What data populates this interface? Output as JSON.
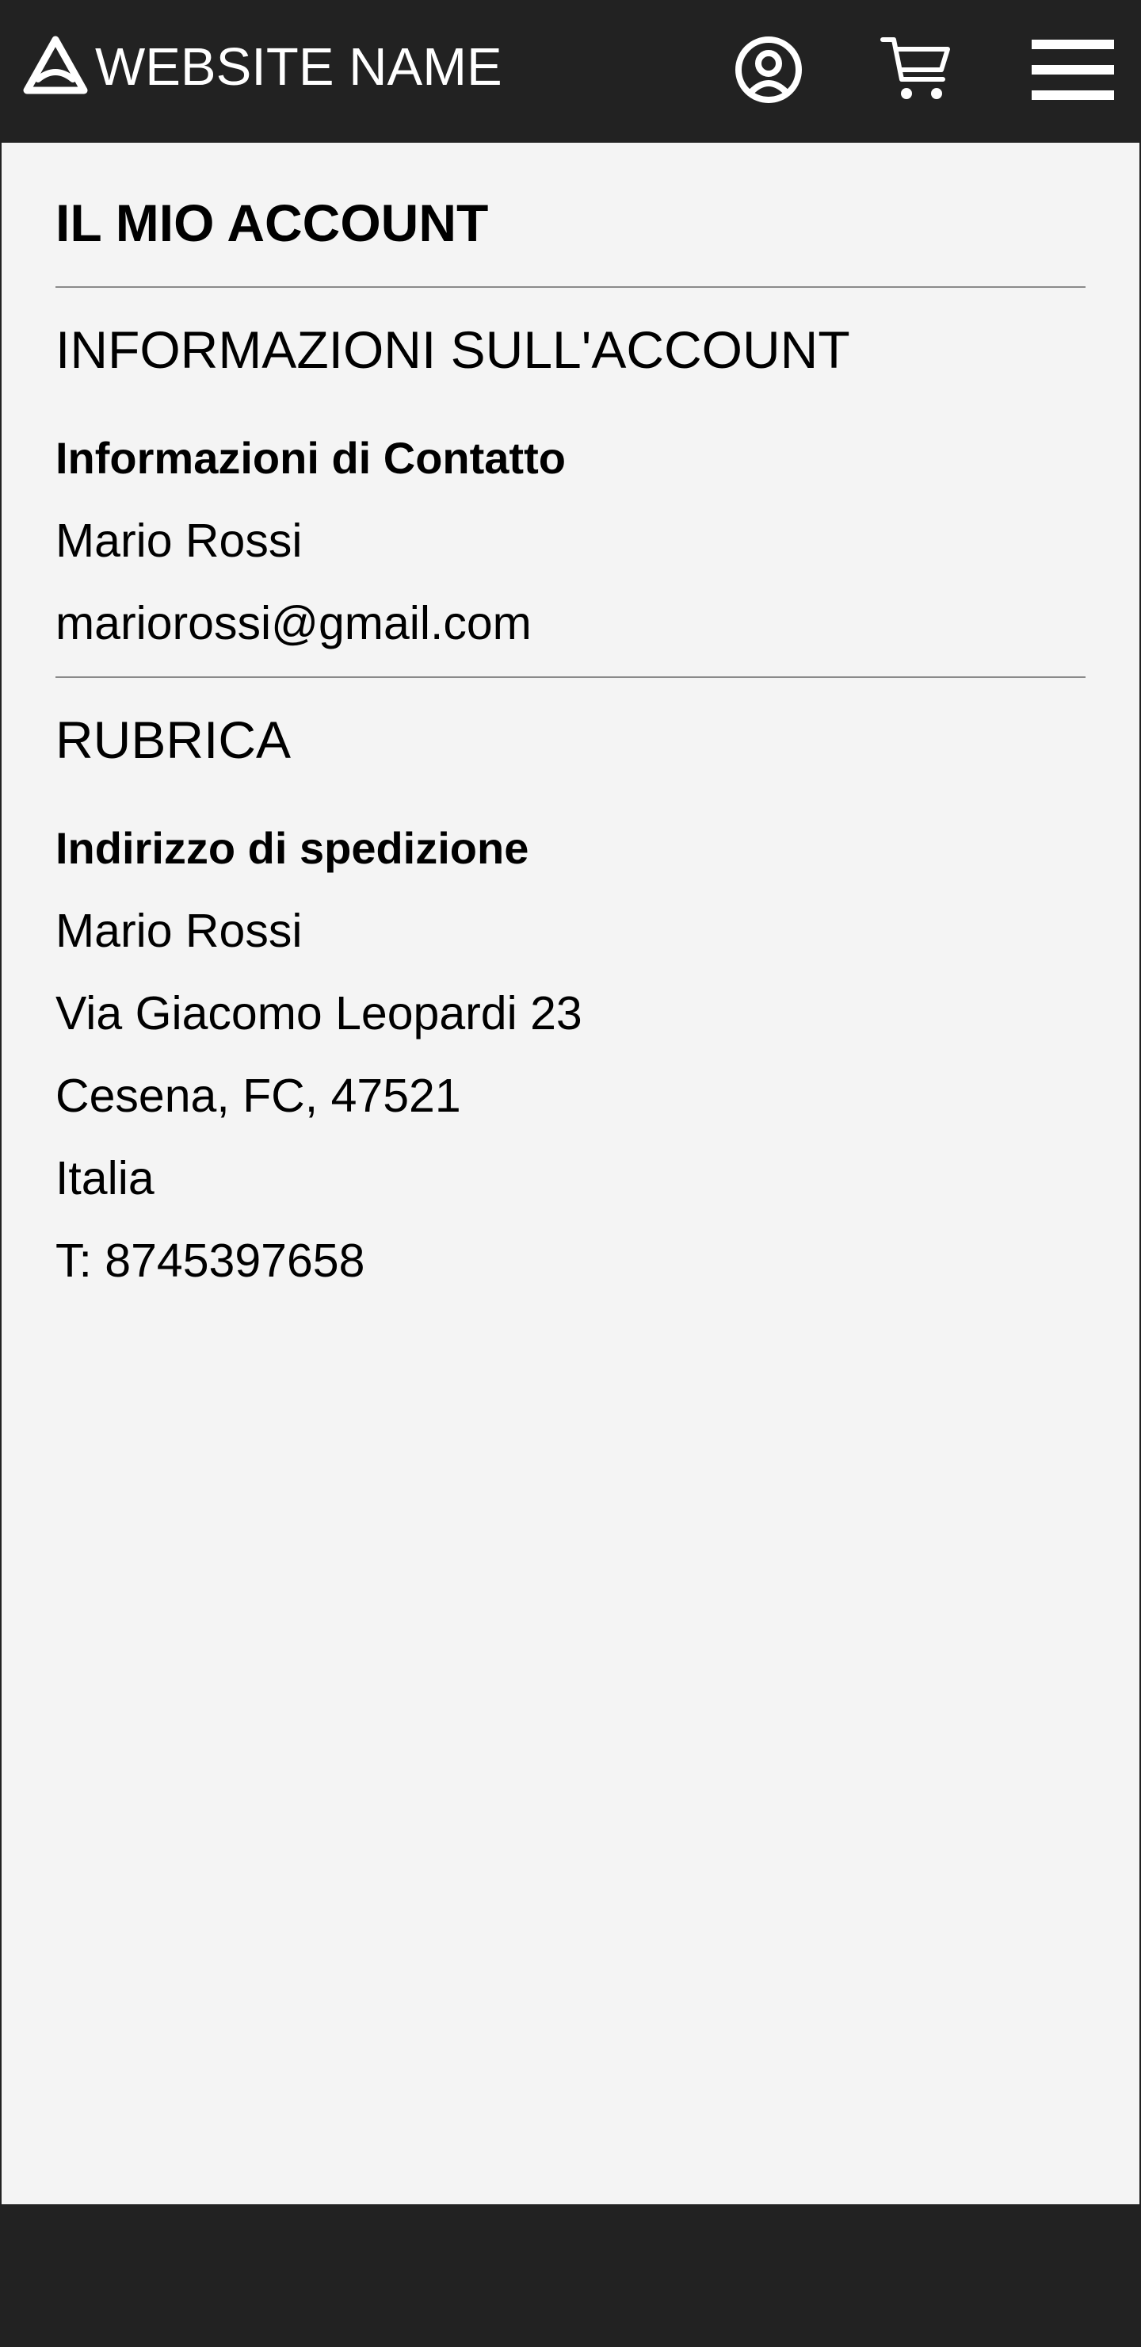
{
  "header": {
    "site_name": "WEBSITE NAME",
    "icons": {
      "logo": "triangle-logo-icon",
      "account": "user-circle-icon",
      "cart": "cart-icon",
      "menu": "hamburger-menu-icon"
    },
    "colors": {
      "background": "#222222",
      "foreground": "#ffffff"
    }
  },
  "main": {
    "page_title": "IL MIO ACCOUNT",
    "account_info": {
      "section_title": "INFORMAZIONI SULL'ACCOUNT",
      "contact_title": "Informazioni di Contatto",
      "name": "Mario Rossi",
      "email": "mariorossi@gmail.com"
    },
    "address_book": {
      "section_title": "RUBRICA",
      "shipping_title": "Indirizzo di spedizione",
      "name": "Mario Rossi",
      "street": "Via Giacomo Leopardi 23",
      "city": "Cesena, FC, 47521",
      "country": "Italia",
      "phone": "T: 8745397658"
    },
    "colors": {
      "background": "#f4f4f4",
      "divider": "#8a8a8a"
    }
  },
  "footer": {
    "colors": {
      "background": "#222222"
    }
  }
}
